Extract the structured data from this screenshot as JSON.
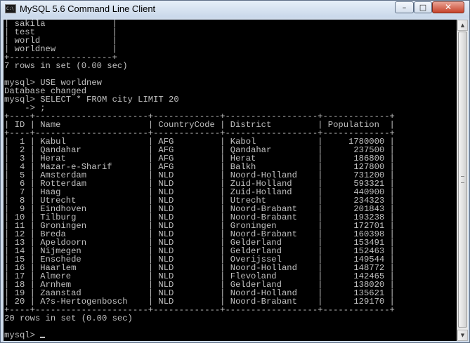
{
  "window": {
    "title": "MySQL 5.6 Command Line Client",
    "icon": "console-icon",
    "icon_text": "C:\\",
    "buttons": {
      "minimize": "–",
      "maximize": "□",
      "close": "✕"
    }
  },
  "console": {
    "lines": [
      "| sakila             |",
      "| test               |",
      "| world              |",
      "| worldnew           |",
      "+--------------------+",
      "7 rows in set (0.00 sec)",
      "",
      "mysql> USE worldnew",
      "Database changed",
      "mysql> SELECT * FROM city LIMIT 20",
      "    -> ;",
      "+----+----------------------+-------------+------------------+-------------+",
      "| ID | Name                 | CountryCode | District         | Population  |",
      "+----+----------------------+-------------+------------------+-------------+",
      "|  1 | Kabul                | AFG         | Kabol            |     1780000 |",
      "|  2 | Qandahar             | AFG         | Qandahar         |      237500 |",
      "|  3 | Herat                | AFG         | Herat            |      186800 |",
      "|  4 | Mazar-e-Sharif       | AFG         | Balkh            |      127800 |",
      "|  5 | Amsterdam            | NLD         | Noord-Holland    |      731200 |",
      "|  6 | Rotterdam            | NLD         | Zuid-Holland     |      593321 |",
      "|  7 | Haag                 | NLD         | Zuid-Holland     |      440900 |",
      "|  8 | Utrecht              | NLD         | Utrecht          |      234323 |",
      "|  9 | Eindhoven            | NLD         | Noord-Brabant    |      201843 |",
      "| 10 | Tilburg              | NLD         | Noord-Brabant    |      193238 |",
      "| 11 | Groningen            | NLD         | Groningen        |      172701 |",
      "| 12 | Breda                | NLD         | Noord-Brabant    |      160398 |",
      "| 13 | Apeldoorn            | NLD         | Gelderland       |      153491 |",
      "| 14 | Nijmegen             | NLD         | Gelderland       |      152463 |",
      "| 15 | Enschede             | NLD         | Overijssel       |      149544 |",
      "| 16 | Haarlem              | NLD         | Noord-Holland    |      148772 |",
      "| 17 | Almere               | NLD         | Flevoland        |      142465 |",
      "| 18 | Arnhem               | NLD         | Gelderland       |      138020 |",
      "| 19 | Zaanstad             | NLD         | Noord-Holland    |      135621 |",
      "| 20 | A?s-Hertogenbosch    | NLD         | Noord-Brabant    |      129170 |",
      "+----+----------------------+-------------+------------------+-------------+",
      "20 rows in set (0.00 sec)",
      "",
      "mysql> "
    ]
  },
  "scrollbar": {
    "up_arrow": "▲",
    "down_arrow": "▼",
    "position": 1.0
  }
}
